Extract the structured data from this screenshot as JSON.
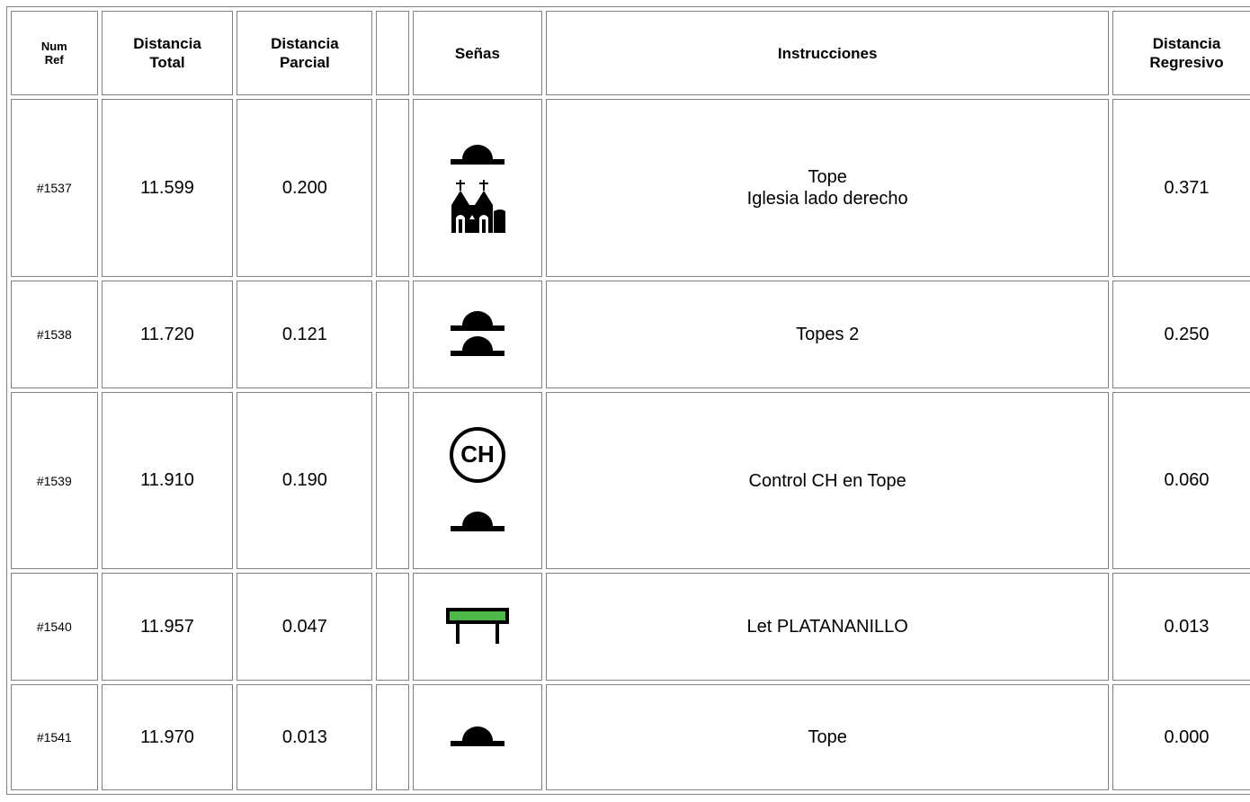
{
  "headers": {
    "num_ref": [
      "Num",
      "Ref"
    ],
    "total": [
      "Distancia",
      "Total"
    ],
    "parcial": [
      "Distancia",
      "Parcial"
    ],
    "blank": "",
    "senas": "Señas",
    "instrucciones": "Instrucciones",
    "regresivo": [
      "Distancia",
      "Regresivo"
    ]
  },
  "rows": [
    {
      "ref": "#1537",
      "total": "11.599",
      "parcial": "0.200",
      "instr": [
        "Tope",
        "Iglesia lado derecho"
      ],
      "regresivo": "0.371",
      "icons": [
        "speed-bump-icon",
        "church-icon"
      ]
    },
    {
      "ref": "#1538",
      "total": "11.720",
      "parcial": "0.121",
      "instr": [
        "Topes 2"
      ],
      "regresivo": "0.250",
      "icons": [
        "double-speed-bump-icon"
      ]
    },
    {
      "ref": "#1539",
      "total": "11.910",
      "parcial": "0.190",
      "instr": [
        "Control CH en Tope"
      ],
      "regresivo": "0.060",
      "icons": [
        "ch-control-icon",
        "speed-bump-icon"
      ]
    },
    {
      "ref": "#1540",
      "total": "11.957",
      "parcial": "0.047",
      "instr": [
        "Let PLATANANILLO"
      ],
      "regresivo": "0.013",
      "icons": [
        "sign-board-icon"
      ]
    },
    {
      "ref": "#1541",
      "total": "11.970",
      "parcial": "0.013",
      "instr": [
        "Tope"
      ],
      "regresivo": "0.000",
      "icons": [
        "speed-bump-icon"
      ]
    }
  ],
  "icon_labels": {
    "ch": "CH"
  },
  "colors": {
    "sign_green": "#4cb848",
    "border": "#808080"
  }
}
